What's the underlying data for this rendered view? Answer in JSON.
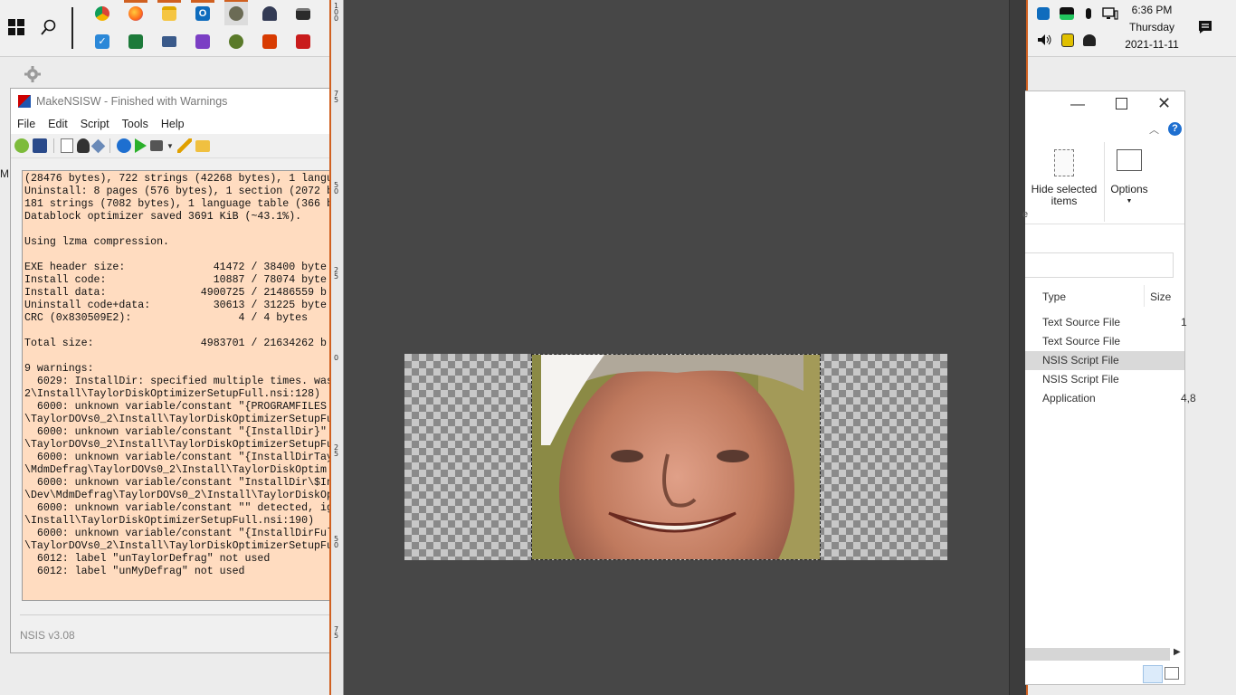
{
  "taskbar": {
    "clock": {
      "time": "6:36 PM",
      "day": "Thursday",
      "date": "2021-11-11"
    },
    "apps_row1": [
      "chrome-icon",
      "firefox-icon",
      "file-explorer-icon",
      "outlook-icon",
      "gimp-icon",
      "gaming-icon",
      "printer-icon"
    ],
    "apps_row2": [
      "todo-icon",
      "excel-icon",
      "remote-desktop-icon",
      "visual-studio-icon",
      "palm-icon",
      "office-icon",
      "acrobat-icon"
    ],
    "colors": {
      "accent": "#d06020"
    }
  },
  "nsis": {
    "title": "MakeNSISW - Finished with Warnings",
    "menu": [
      "File",
      "Edit",
      "Script",
      "Tools",
      "Help"
    ],
    "log_lines": [
      "(28476 bytes), 722 strings (42268 bytes), 1 langu",
      "Uninstall: 8 pages (576 bytes), 1 section (2072 b",
      "181 strings (7082 bytes), 1 language table (366 b",
      "Datablock optimizer saved 3691 KiB (~43.1%).",
      "",
      "Using lzma compression.",
      "",
      "EXE header size:              41472 / 38400 byte",
      "Install code:                 10887 / 78074 byte",
      "Install data:               4900725 / 21486559 b",
      "Uninstall code+data:          30613 / 31225 byte",
      "CRC (0x830509E2):                 4 / 4 bytes",
      "",
      "Total size:                 4983701 / 21634262 b",
      "",
      "9 warnings:",
      "  6029: InstallDir: specified multiple times. was",
      "2\\Install\\TaylorDiskOptimizerSetupFull.nsi:128)",
      "  6000: unknown variable/constant \"{PROGRAMFILES",
      "\\TaylorDOVs0_2\\Install\\TaylorDiskOptimizerSetupFu",
      "  6000: unknown variable/constant \"{InstallDir}\"",
      "\\TaylorDOVs0_2\\Install\\TaylorDiskOptimizerSetupFu",
      "  6000: unknown variable/constant \"{InstallDirTay",
      "\\MdmDefrag\\TaylorDOVs0_2\\Install\\TaylorDiskOptim",
      "  6000: unknown variable/constant \"InstallDir\\$In",
      "\\Dev\\MdmDefrag\\TaylorDOVs0_2\\Install\\TaylorDiskOp",
      "  6000: unknown variable/constant \"\" detected, ig",
      "\\Install\\TaylorDiskOptimizerSetupFull.nsi:190)",
      "  6000: unknown variable/constant \"{InstallDirFul",
      "\\TaylorDOVs0_2\\Install\\TaylorDiskOptimizerSetupFu",
      "  6012: label \"unTaylorDefrag\" not used",
      "  6012: label \"unMyDefrag\" not used"
    ],
    "footer": "NSIS v3.08",
    "log_bg": "#ffdcc0"
  },
  "editor": {
    "ruler_labels_top": [
      "1",
      "0",
      "0"
    ],
    "ruler_marks": [
      {
        "label": "7\n5"
      },
      {
        "label": "5\n0"
      },
      {
        "label": "2\n5"
      },
      {
        "label": "0"
      },
      {
        "label": "2\n5"
      },
      {
        "label": "5\n0"
      },
      {
        "label": "7\n5"
      }
    ],
    "canvas_bg": "#474747"
  },
  "explorer": {
    "ribbon": {
      "hide_selected": "Hide selected items",
      "options": "Options",
      "partial_letter": "e"
    },
    "columns": {
      "type": "Type",
      "size": "Size"
    },
    "rows": [
      {
        "type": "Text Source File",
        "size": "1"
      },
      {
        "type": "Text Source File",
        "size": ""
      },
      {
        "type": "NSIS Script File",
        "size": "",
        "selected": true
      },
      {
        "type": "NSIS Script File",
        "size": ""
      },
      {
        "type": "Application",
        "size": "4,8"
      }
    ],
    "help_symbol": "?"
  }
}
